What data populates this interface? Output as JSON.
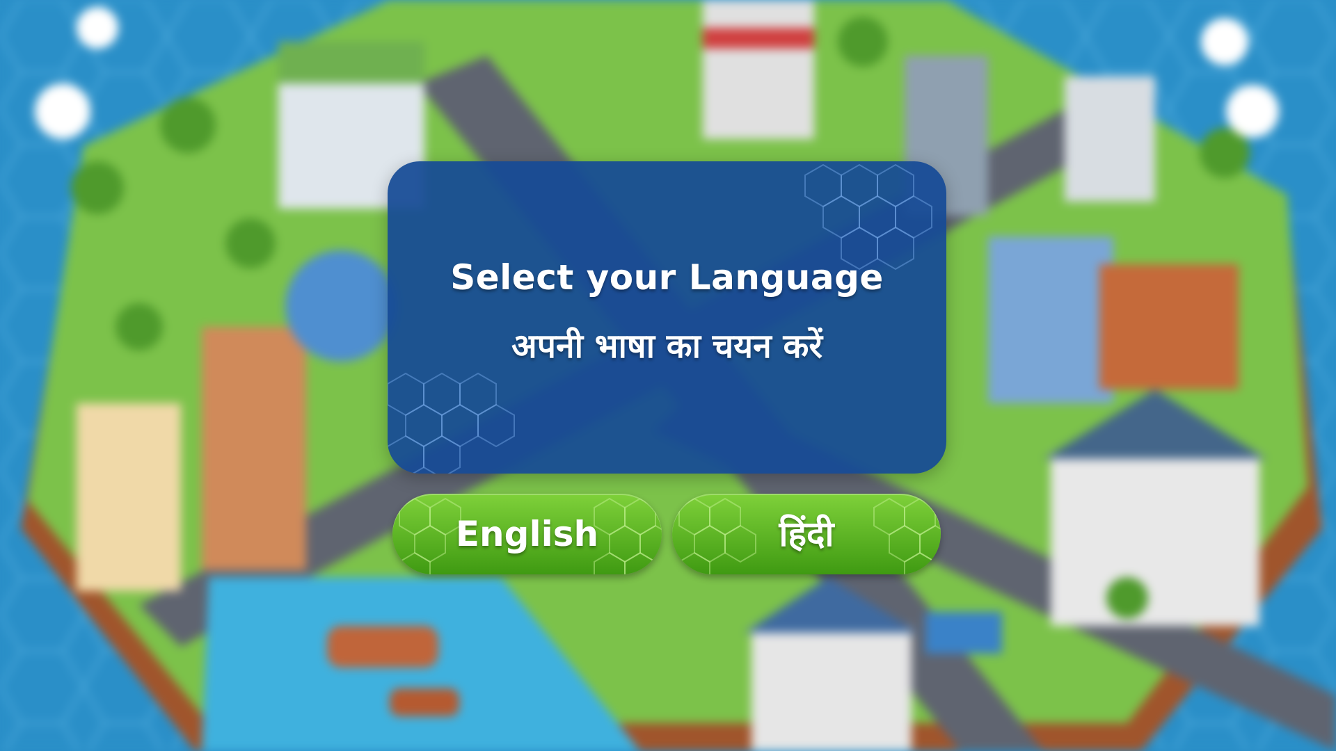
{
  "dialog": {
    "title": "Select your Language",
    "subtitle": "अपनी भाषा का चयन करें"
  },
  "buttons": {
    "english_label": "English",
    "hindi_label": "हिंदी"
  },
  "colors": {
    "dialog_background": "#164a96",
    "button_green": "#5cb524",
    "text": "#ffffff",
    "water": "#2a8fc8"
  }
}
